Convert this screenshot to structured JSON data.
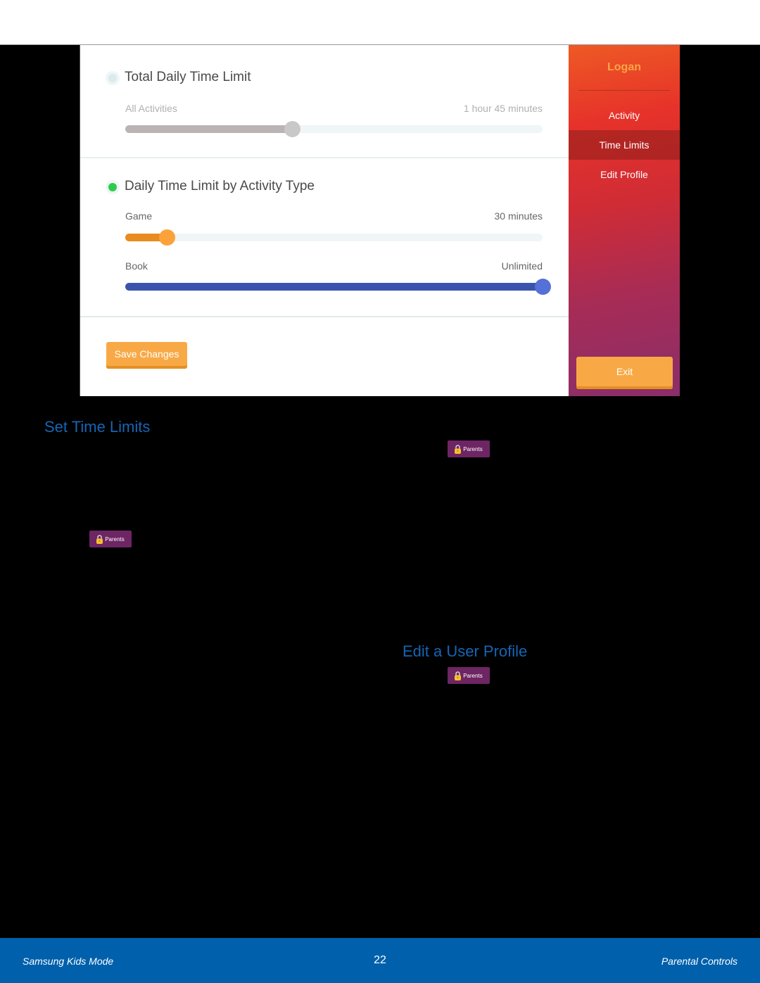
{
  "screenshot": {
    "total_section": {
      "title": "Total Daily Time Limit",
      "enabled": false,
      "row": {
        "label": "All Activities",
        "value": "1 hour 45 minutes",
        "slider_fill_fraction": 0.4,
        "slider_fill_fraction_note": "estimated from thumb position; not a readout"
      }
    },
    "activity_section": {
      "title": "Daily Time Limit by Activity Type",
      "enabled": true,
      "rows": [
        {
          "label": "Game",
          "value": "30 minutes",
          "slider_fill_fraction": 0.1,
          "slider_fill_fraction_note": "estimated from thumb position; not a readout"
        },
        {
          "label": "Book",
          "value": "Unlimited",
          "slider_fill_fraction": 1.0,
          "slider_fill_fraction_note": "estimated from thumb position; not a readout"
        }
      ]
    },
    "save_button": "Save Changes",
    "sidebar": {
      "user_name": "Logan",
      "items": [
        {
          "label": "Activity",
          "active": false
        },
        {
          "label": "Time Limits",
          "active": true
        },
        {
          "label": "Edit Profile",
          "active": false
        }
      ],
      "exit_button": "Exit"
    },
    "colors": {
      "total_slider_fill": "#bab4b4",
      "total_slider_thumb": "#c8c8c8",
      "game_slider_fill": "#ea8b1f",
      "game_slider_thumb": "#fba23a",
      "book_slider_fill": "#3a54ad",
      "book_slider_thumb": "#5570d6",
      "enabled_dot": "#2ecc4a",
      "disabled_dot": "#dceaec"
    }
  },
  "document": {
    "headings": {
      "set_time_limits": "Set Time Limits",
      "edit_profile": "Edit a User Profile"
    },
    "parents_badge_label": "Parents",
    "accent_color": "#1565b5"
  },
  "footer": {
    "left": "Samsung Kids Mode",
    "page_number": "22",
    "right": "Parental Controls"
  }
}
